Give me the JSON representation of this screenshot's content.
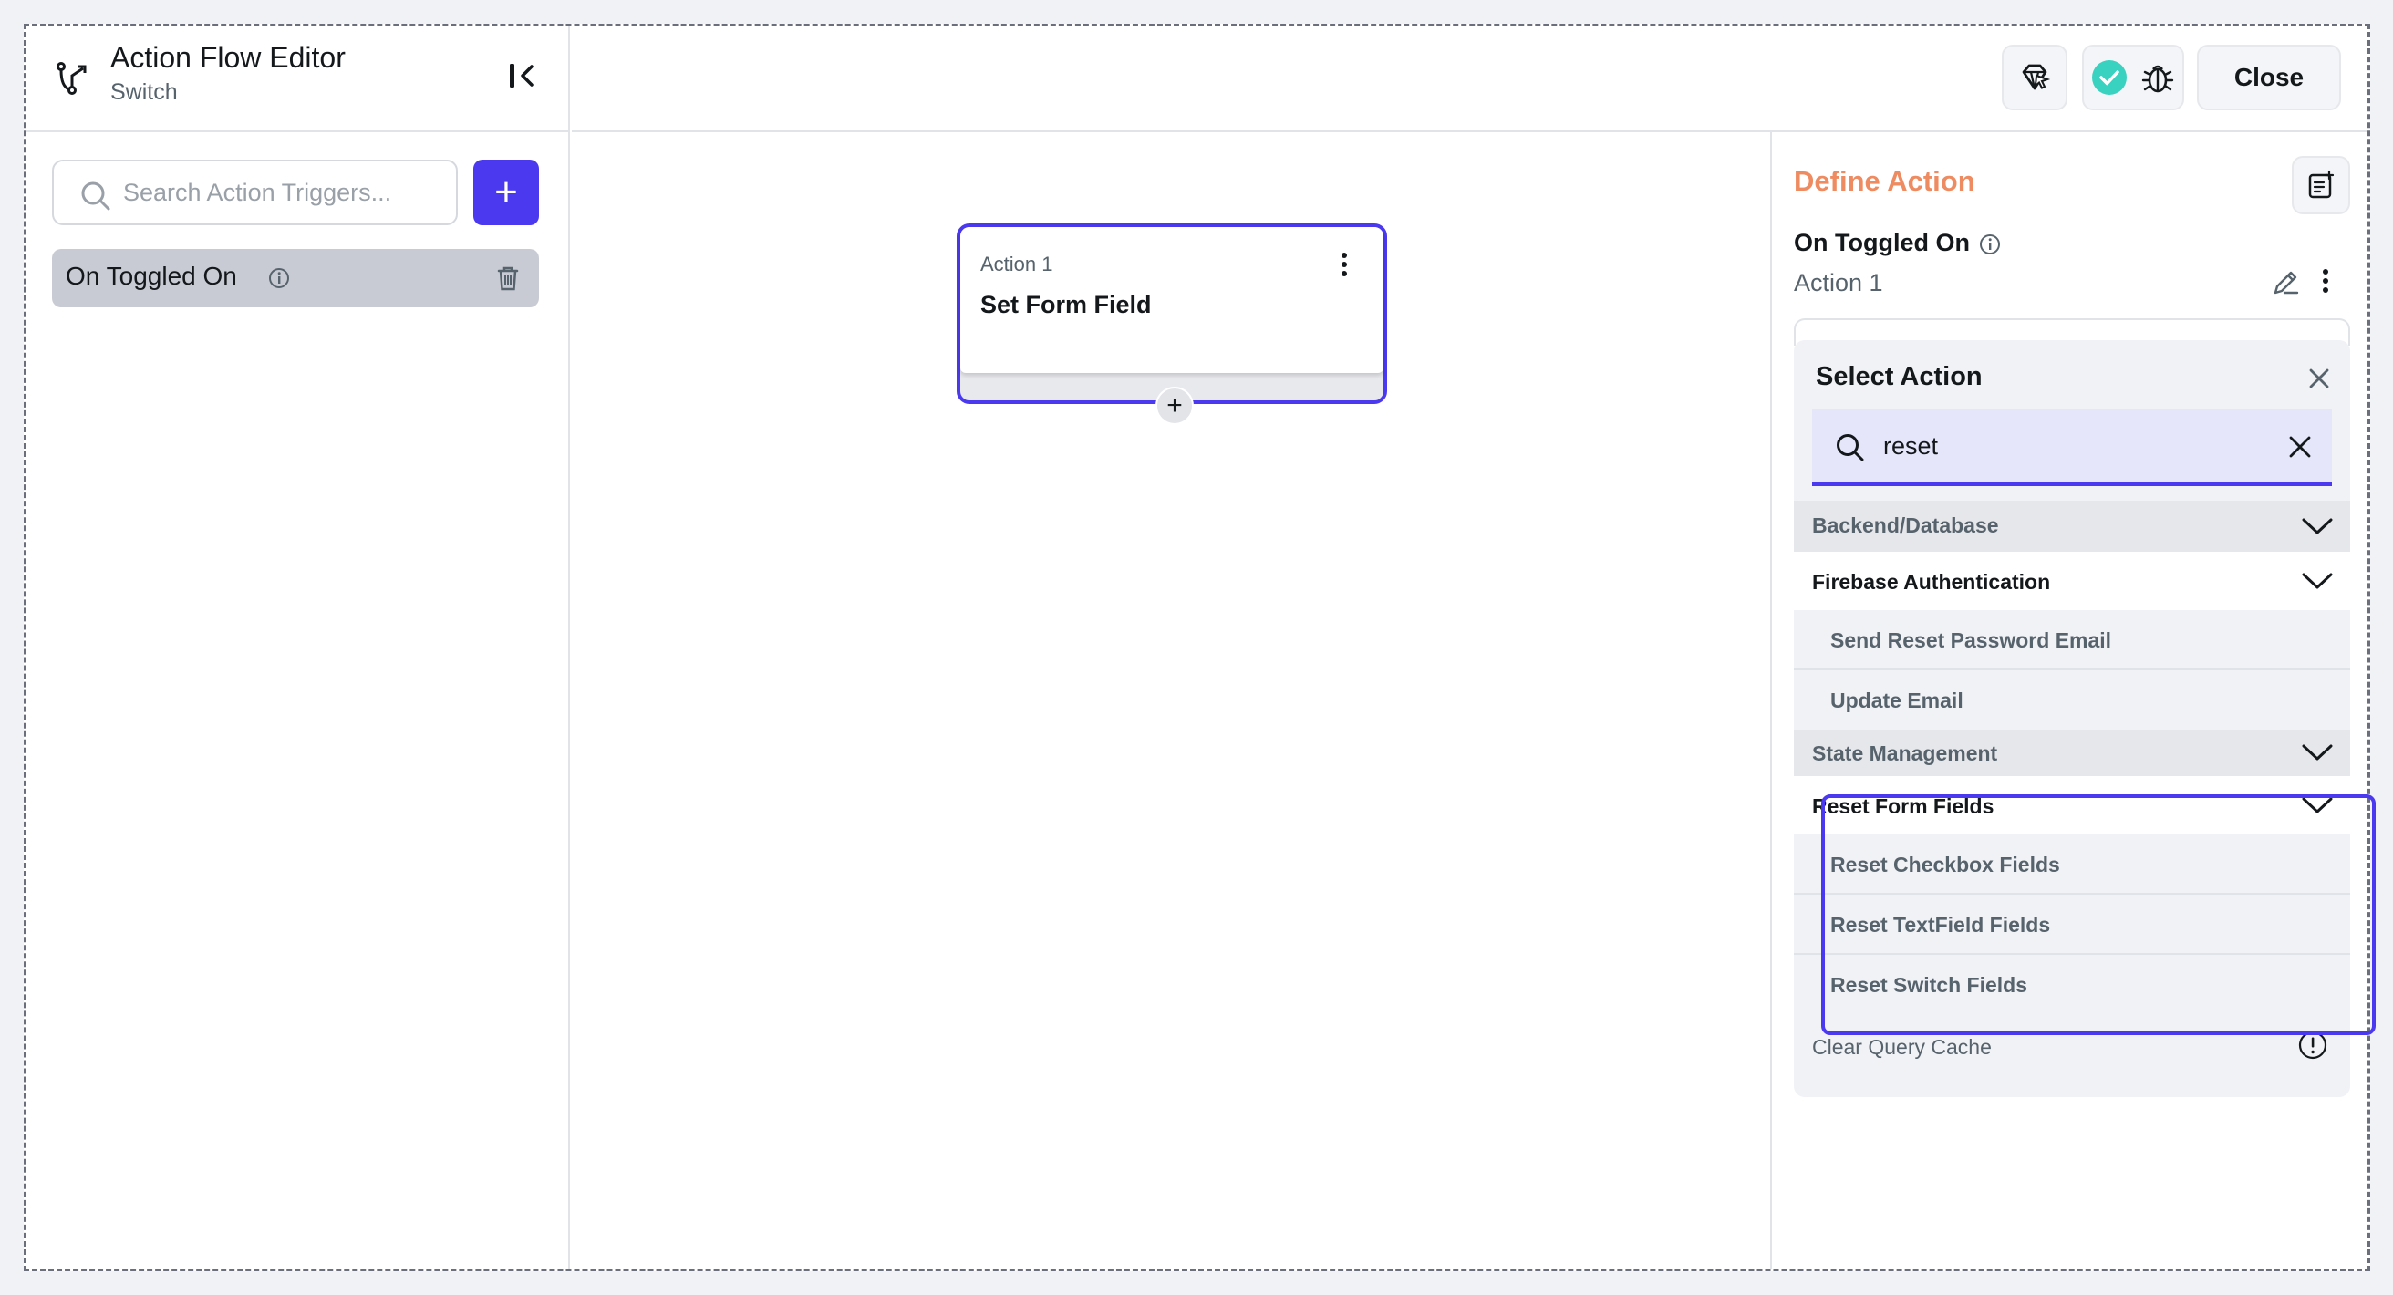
{
  "header": {
    "title": "Action Flow Editor",
    "subtitle": "Switch"
  },
  "left": {
    "search_placeholder": "Search Action Triggers...",
    "add_label": "+",
    "triggers": [
      {
        "label": "On Toggled On"
      }
    ]
  },
  "topbar": {
    "close_label": "Close",
    "status_color": "#39d2c0"
  },
  "canvas": {
    "action_index": "Action 1",
    "action_name": "Set Form Field",
    "add_label": "+"
  },
  "right": {
    "define_title": "Define Action",
    "trigger_name": "On Toggled On",
    "action_label": "Action 1",
    "select": {
      "title": "Select Action",
      "search_value": "reset",
      "categories": {
        "backend": "Backend/Database",
        "firebase_auth": "Firebase Authentication",
        "send_reset": "Send Reset Password Email",
        "update_email": "Update Email",
        "state_mgmt": "State Management",
        "reset_form": "Reset Form Fields",
        "reset_checkbox": "Reset Checkbox Fields",
        "reset_textfield": "Reset TextField Fields",
        "reset_switch": "Reset Switch Fields",
        "clear_cache": "Clear Query Cache"
      }
    }
  },
  "colors": {
    "primary": "#4b39ef",
    "accent_orange": "#ee8b60"
  }
}
